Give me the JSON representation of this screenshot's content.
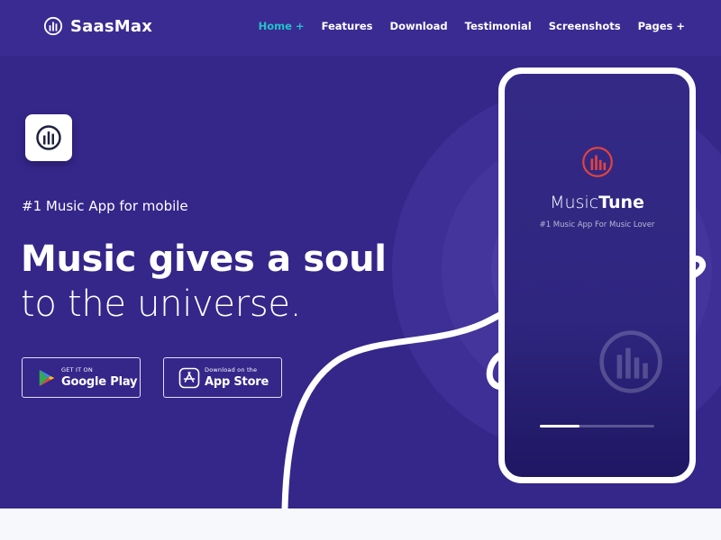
{
  "brand": {
    "name": "SaasMax",
    "icon": "equalizer-circle-icon"
  },
  "nav": {
    "items": [
      {
        "label": "Home +",
        "active": true
      },
      {
        "label": "Features"
      },
      {
        "label": "Download"
      },
      {
        "label": "Testimonial"
      },
      {
        "label": "Screenshots"
      },
      {
        "label": "Pages +"
      }
    ]
  },
  "hero": {
    "app_icon": "equalizer-circle-icon",
    "tagline": "#1 Music App for mobile",
    "headline": "Music gives a soul",
    "subheadline": "to the universe.",
    "buttons": {
      "google_play": {
        "small": "GET IT ON",
        "big": "Google Play",
        "icon": "google-play-icon"
      },
      "app_store": {
        "small": "Download on the",
        "big": "App Store",
        "icon": "app-store-icon"
      }
    }
  },
  "phone": {
    "logo_icon": "equalizer-circle-icon",
    "app_name_light": "Music",
    "app_name_bold": "Tune",
    "tagline": "#1 Music App For Music Lover",
    "progress": 0.35
  },
  "colors": {
    "background": "#35268a",
    "navbar": "#3a2b92",
    "accent": "#23c2c8",
    "logo_red": "#e0433f",
    "bottom_strip": "#f7f8fb"
  }
}
